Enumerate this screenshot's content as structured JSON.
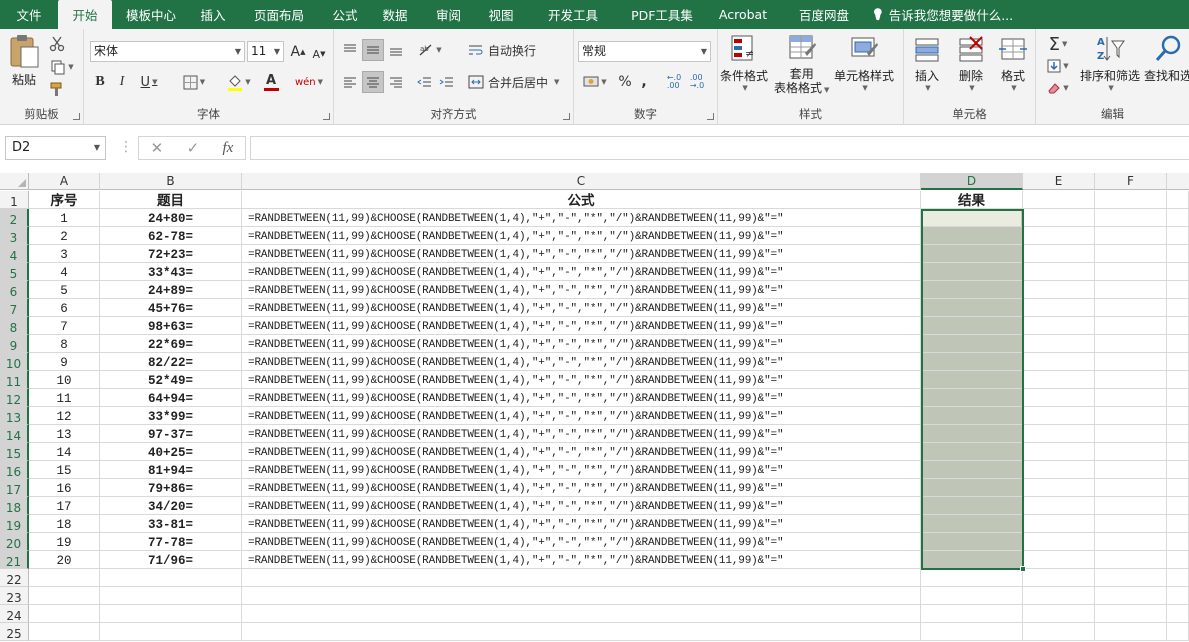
{
  "menu": {
    "tabs": [
      "文件",
      "开始",
      "模板中心",
      "插入",
      "页面布局",
      "公式",
      "数据",
      "审阅",
      "视图",
      "开发工具",
      "PDF工具集",
      "Acrobat",
      "百度网盘"
    ],
    "active": "开始",
    "tell_me": "告诉我您想要做什么..."
  },
  "ribbon": {
    "clipboard": {
      "label": "剪贴板",
      "paste": "粘贴"
    },
    "font": {
      "label": "字体",
      "name": "宋体",
      "size": "11",
      "bold": "B",
      "italic": "I",
      "underline": "U",
      "grow": "A",
      "shrink": "A",
      "color_letter": "A",
      "phonetic": "wén"
    },
    "alignment": {
      "label": "对齐方式",
      "wrap": "自动换行",
      "merge": "合并后居中"
    },
    "number": {
      "label": "数字",
      "format": "常规",
      "percent": "%",
      "comma": ",",
      "inc_decimal": "←.0\n.00",
      "dec_decimal": ".00\n→.0"
    },
    "styles": {
      "label": "样式",
      "conditional": "条件格式",
      "table1": "套用",
      "table2": "表格格式",
      "cell_styles": "单元格样式"
    },
    "cells": {
      "label": "单元格",
      "insert": "插入",
      "delete": "删除",
      "format": "格式"
    },
    "editing": {
      "label": "编辑",
      "sort": "排序和筛选",
      "find": "查找和选"
    }
  },
  "formula_bar": {
    "name_box": "D2",
    "cancel": "✕",
    "enter": "✓",
    "fx": "fx",
    "content": ""
  },
  "sheet": {
    "columns": [
      "A",
      "B",
      "C",
      "D",
      "E",
      "F"
    ],
    "selected_column": "D",
    "headers": {
      "A": "序号",
      "B": "题目",
      "C": "公式",
      "D": "结果"
    },
    "formula_text": "=RANDBETWEEN(11,99)&CHOOSE(RANDBETWEEN(1,4),\"+\",\"-\",\"*\",\"/\")&RANDBETWEEN(11,99)&\"=\"",
    "rows": [
      {
        "n": "1",
        "q": "24+80="
      },
      {
        "n": "2",
        "q": "62-78="
      },
      {
        "n": "3",
        "q": "72+23="
      },
      {
        "n": "4",
        "q": "33*43="
      },
      {
        "n": "5",
        "q": "24+89="
      },
      {
        "n": "6",
        "q": "45+76="
      },
      {
        "n": "7",
        "q": "98+63="
      },
      {
        "n": "8",
        "q": "22*69="
      },
      {
        "n": "9",
        "q": "82/22="
      },
      {
        "n": "10",
        "q": "52*49="
      },
      {
        "n": "11",
        "q": "64+94="
      },
      {
        "n": "12",
        "q": "33*99="
      },
      {
        "n": "13",
        "q": "97-37="
      },
      {
        "n": "14",
        "q": "40+25="
      },
      {
        "n": "15",
        "q": "81+94="
      },
      {
        "n": "16",
        "q": "79+86="
      },
      {
        "n": "17",
        "q": "34/20="
      },
      {
        "n": "18",
        "q": "33-81="
      },
      {
        "n": "19",
        "q": "77-78="
      },
      {
        "n": "20",
        "q": "71/96="
      }
    ],
    "row_numbers": [
      "1",
      "2",
      "3",
      "4",
      "5",
      "6",
      "7",
      "8",
      "9",
      "10",
      "11",
      "12",
      "13",
      "14",
      "15",
      "16",
      "17",
      "18",
      "19",
      "20",
      "21",
      "22",
      "23",
      "24",
      "25"
    ],
    "colors": {
      "accent": "#217346",
      "selection": "#bfc6b8"
    }
  }
}
